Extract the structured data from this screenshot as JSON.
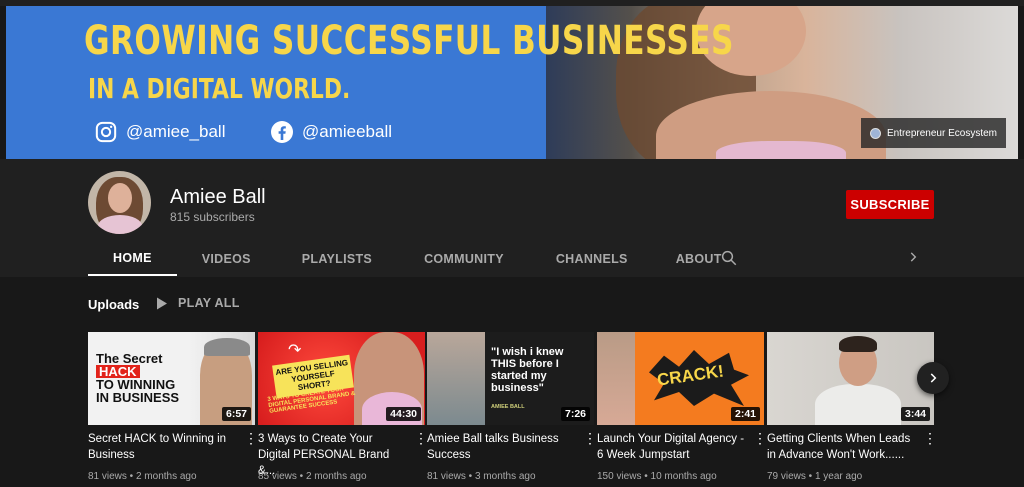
{
  "banner": {
    "title": "GROWING SUCCESSFUL BUSINESSES",
    "subtitle": "IN A DIGITAL WORLD.",
    "instagram": "@amiee_ball",
    "facebook": "@amieeball",
    "link_label": "Entrepreneur Ecosystem"
  },
  "channel": {
    "name": "Amiee Ball",
    "subscribers": "815 subscribers",
    "subscribe_label": "SUBSCRIBE"
  },
  "tabs": [
    {
      "label": "HOME",
      "active": true
    },
    {
      "label": "VIDEOS"
    },
    {
      "label": "PLAYLISTS"
    },
    {
      "label": "COMMUNITY"
    },
    {
      "label": "CHANNELS"
    },
    {
      "label": "ABOUT"
    }
  ],
  "uploads": {
    "title": "Uploads",
    "play_all": "PLAY ALL"
  },
  "videos": [
    {
      "title": "Secret HACK to Winning in Business",
      "duration": "6:57",
      "meta": "81 views • 2 months ago",
      "thumb": {
        "line1": "The Secret",
        "line2": "HACK",
        "line3": "TO WINNING",
        "line4": "IN BUSINESS"
      }
    },
    {
      "title": "3 Ways to Create Your Digital PERSONAL Brand &...",
      "duration": "44:30",
      "meta": "85 views • 2 months ago",
      "thumb": {
        "line1": "ARE YOU SELLING YOURSELF SHORT?",
        "line2": "3 WAYS TO CREATE YOUR DIGITAL PERSONAL BRAND & GUARANTEE SUCCESS"
      }
    },
    {
      "title": "Amiee Ball talks Business Success",
      "duration": "7:26",
      "meta": "81 views • 3 months ago",
      "thumb": {
        "line1": "\"I wish i knew THIS before I started my business\"",
        "line2": "AMIEE BALL"
      }
    },
    {
      "title": "Launch Your Digital Agency - 6 Week Jumpstart",
      "duration": "2:41",
      "meta": "150 views • 10 months ago",
      "thumb": {
        "line1": "CRACK!"
      }
    },
    {
      "title": "Getting Clients When Leads in Advance Won't Work......",
      "duration": "3:44",
      "meta": "79 views • 1 year ago",
      "thumb": {}
    }
  ],
  "colors": {
    "banner_bg": "#3a78d4",
    "banner_text": "#f7d64a",
    "subscribe": "#cc0000",
    "page_bg": "#181818",
    "header_bg": "#202020"
  }
}
